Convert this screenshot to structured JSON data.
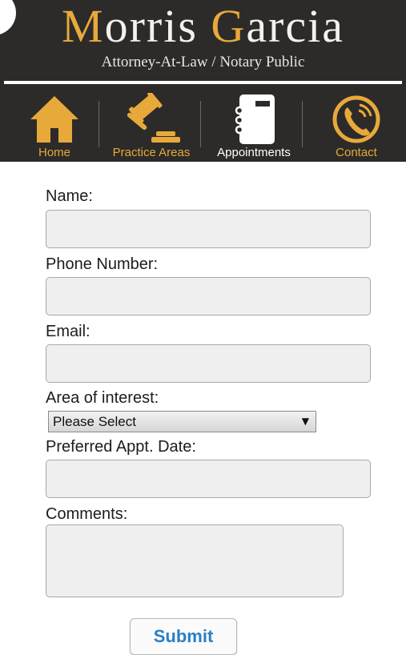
{
  "header": {
    "brand_first": "Morris",
    "brand_last": "Garcia",
    "subtitle": "Attorney-At-Law / Notary Public"
  },
  "back_button": {
    "icon": "chevron-right-icon",
    "glyph": "›"
  },
  "nav": {
    "items": [
      {
        "label": "Home",
        "icon": "home-icon"
      },
      {
        "label": "Practice Areas",
        "icon": "gavel-icon"
      },
      {
        "label": "Appointments",
        "icon": "notebook-icon",
        "active": true
      },
      {
        "label": "Contact",
        "icon": "phone-icon"
      }
    ]
  },
  "form": {
    "name_label": "Name:",
    "name_value": "",
    "phone_label": "Phone Number:",
    "phone_value": "",
    "email_label": "Email:",
    "email_value": "",
    "interest_label": "Area of interest:",
    "interest_selected": "Please Select",
    "date_label": "Preferred Appt. Date:",
    "date_value": "",
    "comments_label": "Comments:",
    "comments_value": "",
    "submit_label": "Submit"
  },
  "colors": {
    "header_bg": "#2c2b29",
    "accent": "#e8a93b",
    "submit_text": "#2a7fc4"
  }
}
